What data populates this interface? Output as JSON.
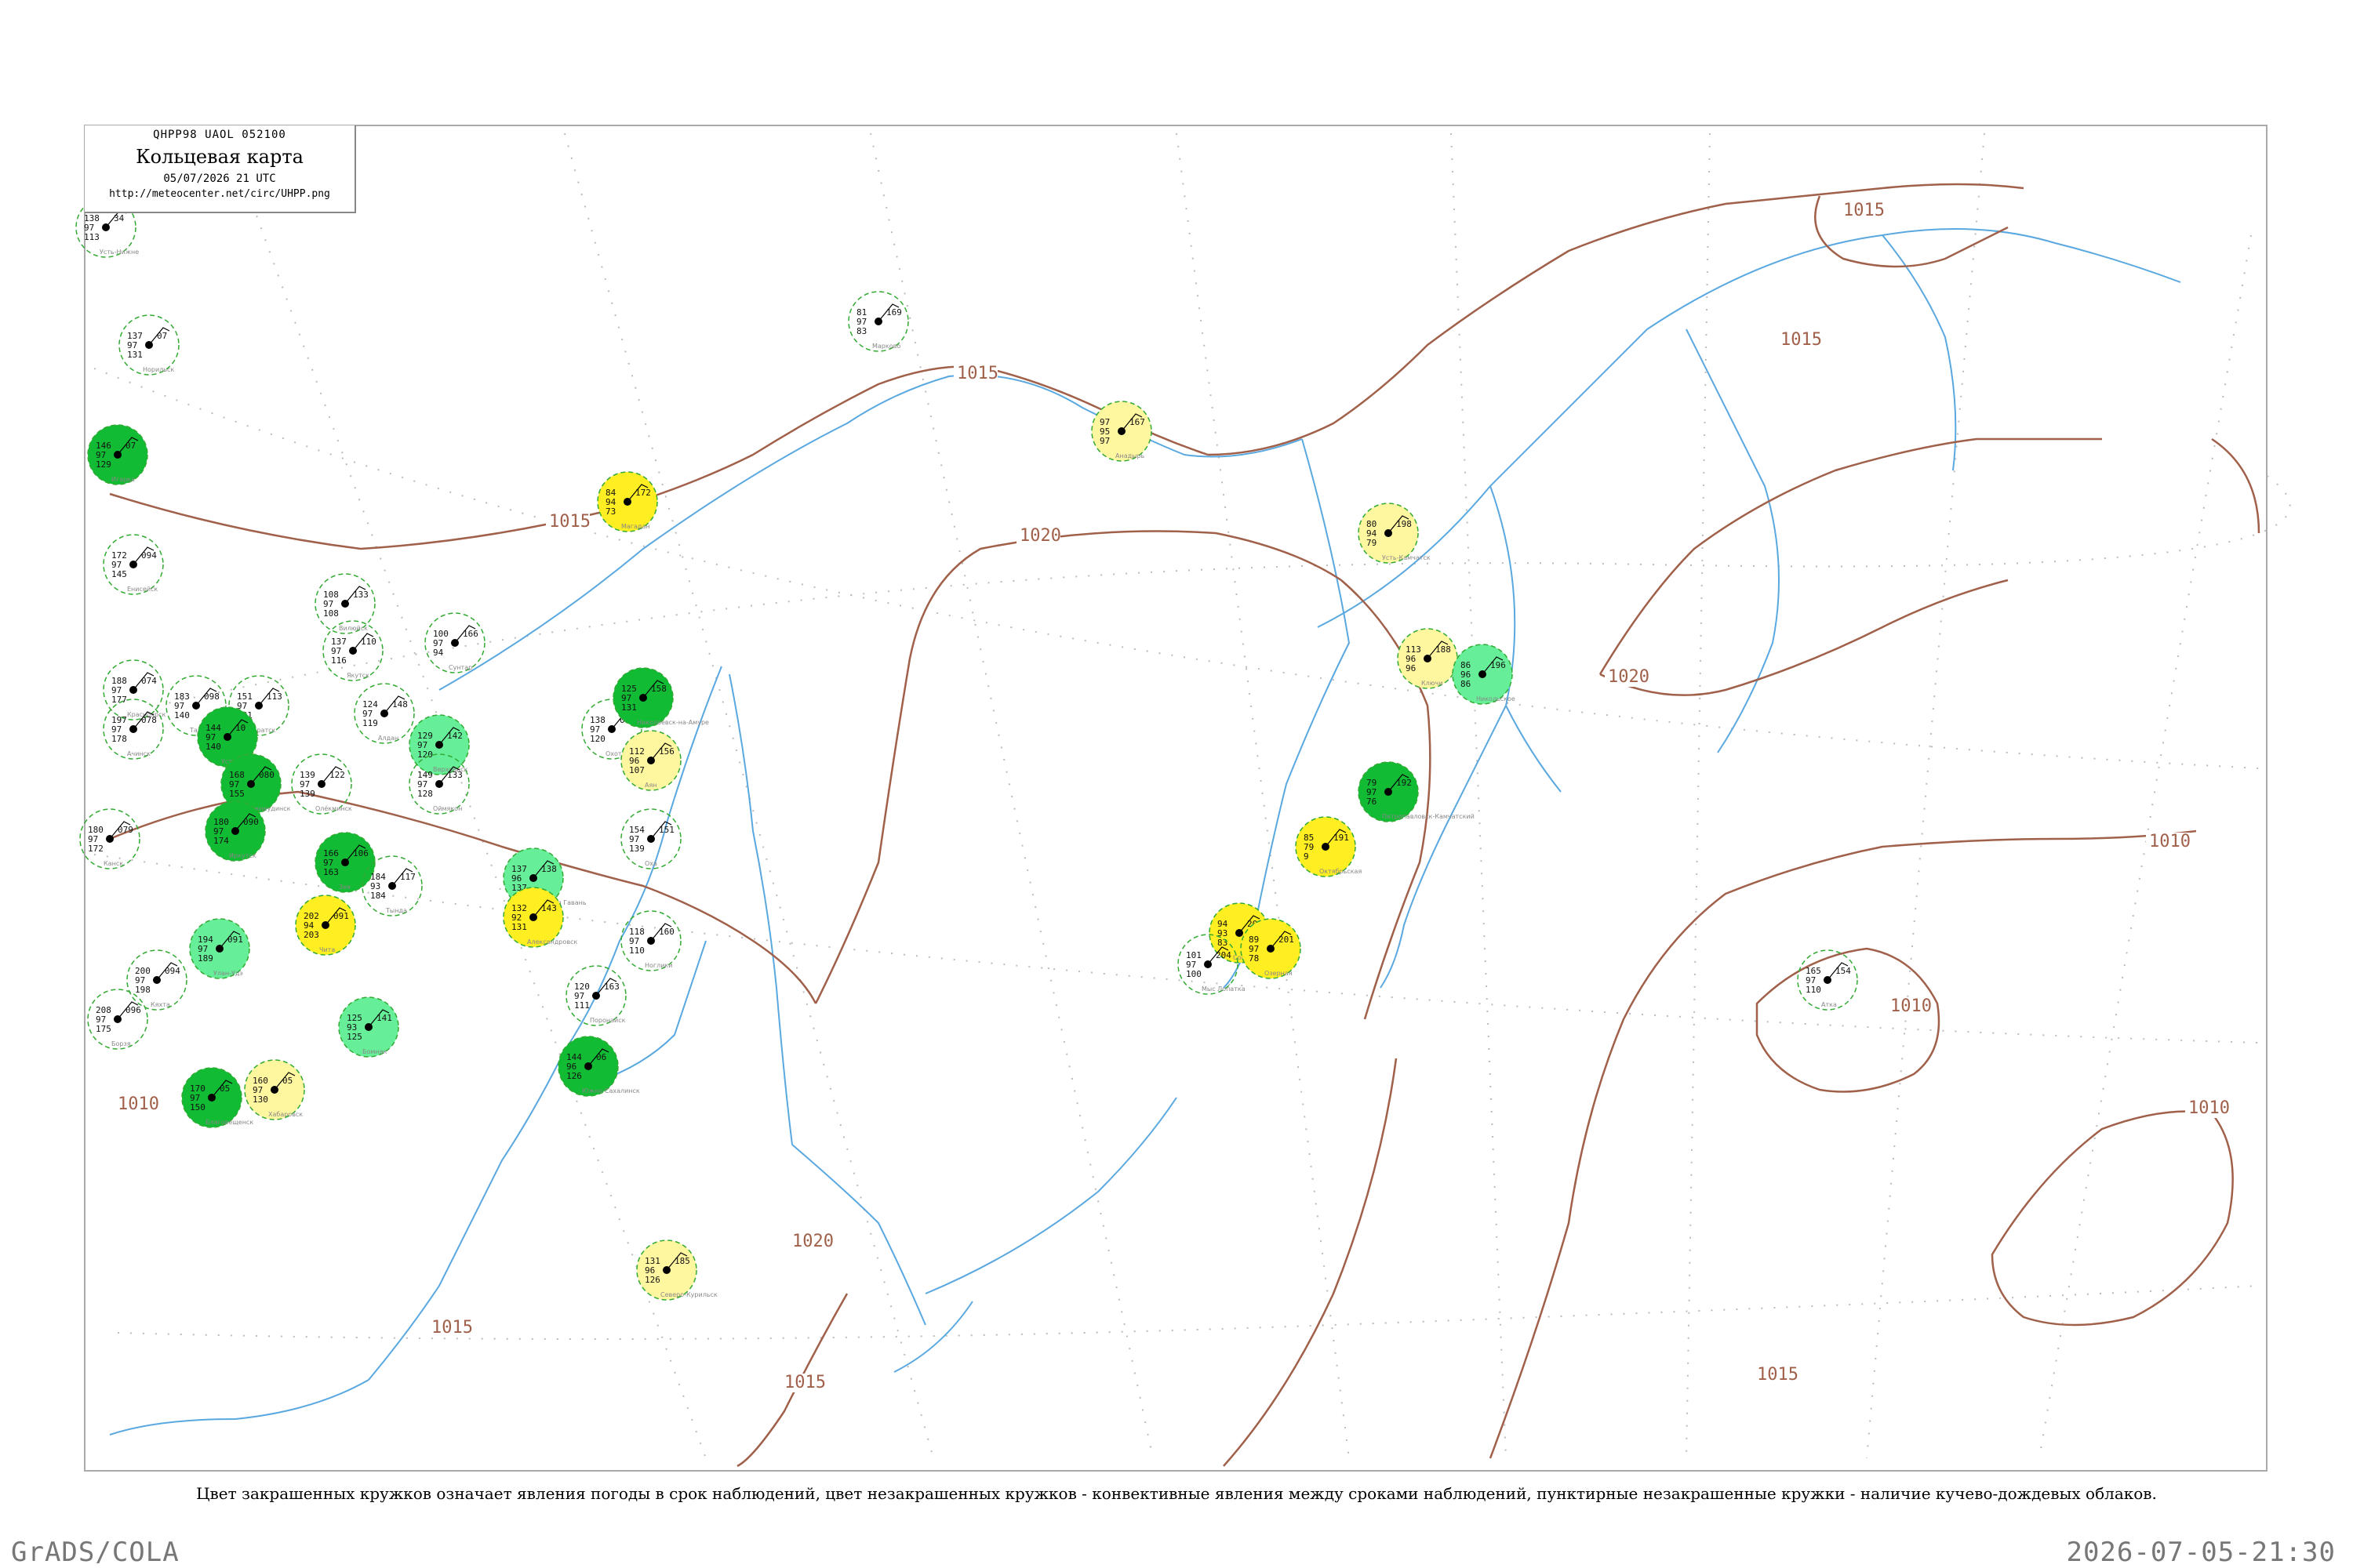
{
  "header": {
    "code": "QHPP98  UAOL  052100",
    "title": "Кольцевая карта",
    "datetime": "05/07/2026 21 UTC",
    "url": "http://meteocenter.net/circ/UHPP.png"
  },
  "caption": "Цвет закрашенных кружков означает явления погоды в срок наблюдений, цвет незакрашенных кружков - конвективные явления между сроками наблюдений, пунктирные незакрашенные кружки - наличие кучево-дождевых облаков.",
  "footer": {
    "left": "GrADS/COLA",
    "right": "2026-07-05-21:30"
  },
  "colors": {
    "isobar": "#a0604a",
    "water": "#5aa8e0",
    "grid": "#aaaaaa",
    "fill_dark_green": "#11bb33",
    "fill_light_green": "#66ee99",
    "fill_yellow": "#ffee22",
    "fill_pale_yellow": "#fff6a0",
    "dashed_ring": "#33aa33"
  },
  "isobar_labels": [
    "1015",
    "1015",
    "1015",
    "1020",
    "1020",
    "1020",
    "1015",
    "1015",
    "1010",
    "1010",
    "1010",
    "1015",
    "1015",
    "1010"
  ],
  "stations": [
    {
      "name": "Усть-Нижне",
      "t": "138",
      "p": "34",
      "rh": "97",
      "dp": "113",
      "fill": "none"
    },
    {
      "name": "Норильск",
      "t": "137",
      "p": "07",
      "rh": "97",
      "dp": "131",
      "fill": "none"
    },
    {
      "name": "Игарка",
      "t": "146",
      "p": "07",
      "rh": "97",
      "dp": "129",
      "fill": "dark"
    },
    {
      "name": "Енисейск",
      "t": "172",
      "p": "094",
      "rh": "97",
      "dp": "145",
      "fill": "none"
    },
    {
      "name": "Красноярск",
      "t": "188",
      "p": "074",
      "rh": "97",
      "dp": "177",
      "fill": "none"
    },
    {
      "name": "Ачинск",
      "t": "197",
      "p": "078",
      "rh": "97",
      "dp": "178",
      "fill": "none"
    },
    {
      "name": "Канск",
      "t": "180",
      "p": "079",
      "rh": "97",
      "dp": "172",
      "fill": "none"
    },
    {
      "name": "Тайшет",
      "t": "183",
      "p": "098",
      "rh": "97",
      "dp": "140",
      "fill": "none"
    },
    {
      "name": "Братск",
      "t": "151",
      "p": "113",
      "rh": "97",
      "dp": "141",
      "fill": "none"
    },
    {
      "name": "Усть-Кут",
      "t": "144",
      "p": "10",
      "rh": "97",
      "dp": "140",
      "fill": "dark"
    },
    {
      "name": "Нижнеудинск",
      "t": "168",
      "p": "080",
      "rh": "97",
      "dp": "155",
      "fill": "dark"
    },
    {
      "name": "Иркутск",
      "t": "180",
      "p": "090",
      "rh": "97",
      "dp": "174",
      "fill": "dark"
    },
    {
      "name": "Улан-Удэ",
      "t": "194",
      "p": "091",
      "rh": "97",
      "dp": "189",
      "fill": "light"
    },
    {
      "name": "Чита",
      "t": "202",
      "p": "091",
      "rh": "94",
      "dp": "203",
      "fill": "yellow"
    },
    {
      "name": "Кяхта",
      "t": "200",
      "p": "094",
      "rh": "97",
      "dp": "198",
      "fill": "none"
    },
    {
      "name": "Борзя",
      "t": "208",
      "p": "096",
      "rh": "97",
      "dp": "175",
      "fill": "none"
    },
    {
      "name": "Благовещенск",
      "t": "170",
      "p": "05",
      "rh": "97",
      "dp": "150",
      "fill": "dark"
    },
    {
      "name": "Хабаровск",
      "t": "160",
      "p": "05",
      "rh": "97",
      "dp": "130",
      "fill": "pale"
    },
    {
      "name": "Бомнак",
      "t": "125",
      "p": "141",
      "rh": "93",
      "dp": "125",
      "fill": "light"
    },
    {
      "name": "Зея",
      "t": "166",
      "p": "106",
      "rh": "97",
      "dp": "163",
      "fill": "dark"
    },
    {
      "name": "Тында",
      "t": "184",
      "p": "117",
      "rh": "93",
      "dp": "184",
      "fill": "none"
    },
    {
      "name": "Олёкминск",
      "t": "139",
      "p": "122",
      "rh": "97",
      "dp": "139",
      "fill": "none"
    },
    {
      "name": "Алдан",
      "t": "124",
      "p": "148",
      "rh": "97",
      "dp": "119",
      "fill": "none"
    },
    {
      "name": "Якутск",
      "t": "137",
      "p": "110",
      "rh": "97",
      "dp": "116",
      "fill": "none"
    },
    {
      "name": "Вилюйск",
      "t": "108",
      "p": "133",
      "rh": "97",
      "dp": "108",
      "fill": "none"
    },
    {
      "name": "Сунтар",
      "t": "100",
      "p": "166",
      "rh": "97",
      "dp": "94",
      "fill": "none"
    },
    {
      "name": "Верхоянск",
      "t": "129",
      "p": "142",
      "rh": "97",
      "dp": "120",
      "fill": "light"
    },
    {
      "name": "Оймякон",
      "t": "149",
      "p": "133",
      "rh": "97",
      "dp": "128",
      "fill": "none"
    },
    {
      "name": "Охотск",
      "t": "138",
      "p": "04",
      "rh": "97",
      "dp": "120",
      "fill": "none"
    },
    {
      "name": "Аян",
      "t": "112",
      "p": "156",
      "rh": "96",
      "dp": "107",
      "fill": "pale"
    },
    {
      "name": "Николаевск-на-Амуре",
      "t": "125",
      "p": "158",
      "rh": "97",
      "dp": "131",
      "fill": "dark"
    },
    {
      "name": "Советская Гавань",
      "t": "137",
      "p": "138",
      "rh": "96",
      "dp": "137",
      "fill": "light"
    },
    {
      "name": "Александровск",
      "t": "132",
      "p": "143",
      "rh": "92",
      "dp": "131",
      "fill": "yellow"
    },
    {
      "name": "Оха",
      "t": "154",
      "p": "151",
      "rh": "97",
      "dp": "139",
      "fill": "none"
    },
    {
      "name": "Ноглики",
      "t": "118",
      "p": "160",
      "rh": "97",
      "dp": "110",
      "fill": "none"
    },
    {
      "name": "Поронайск",
      "t": "120",
      "p": "163",
      "rh": "97",
      "dp": "111",
      "fill": "none"
    },
    {
      "name": "Южно-Сахалинск",
      "t": "144",
      "p": "06",
      "rh": "96",
      "dp": "126",
      "fill": "dark"
    },
    {
      "name": "Магадан",
      "t": "84",
      "p": "172",
      "rh": "94",
      "dp": "73",
      "fill": "yellow"
    },
    {
      "name": "Северо-Курильск",
      "t": "131",
      "p": "185",
      "rh": "96",
      "dp": "126",
      "fill": "pale"
    },
    {
      "name": "Анадырь",
      "t": "97",
      "p": "167",
      "rh": "95",
      "dp": "97",
      "fill": "pale"
    },
    {
      "name": "Марково",
      "t": "81",
      "p": "169",
      "rh": "97",
      "dp": "83",
      "fill": "none"
    },
    {
      "name": "Усть-Камчатск",
      "t": "80",
      "p": "198",
      "rh": "94",
      "dp": "79",
      "fill": "pale"
    },
    {
      "name": "Ключи",
      "t": "113",
      "p": "188",
      "rh": "96",
      "dp": "96",
      "fill": "pale"
    },
    {
      "name": "Никольское",
      "t": "86",
      "p": "196",
      "rh": "96",
      "dp": "86",
      "fill": "light"
    },
    {
      "name": "Петропавловск-Камчатский",
      "t": "79",
      "p": "192",
      "rh": "97",
      "dp": "76",
      "fill": "dark"
    },
    {
      "name": "Октябрьская",
      "t": "85",
      "p": "191",
      "rh": "79",
      "dp": "9",
      "fill": "yellow"
    },
    {
      "name": "Соболево",
      "t": "94",
      "p": "209",
      "rh": "93",
      "dp": "83",
      "fill": "yellow"
    },
    {
      "name": "Озерная",
      "t": "89",
      "p": "201",
      "rh": "97",
      "dp": "78",
      "fill": "yellow"
    },
    {
      "name": "Мыс Лопатка",
      "t": "101",
      "p": "204",
      "rh": "97",
      "dp": "100",
      "fill": "none"
    },
    {
      "name": "Атка",
      "t": "165",
      "p": "154",
      "rh": "97",
      "dp": "110",
      "fill": "none"
    }
  ]
}
